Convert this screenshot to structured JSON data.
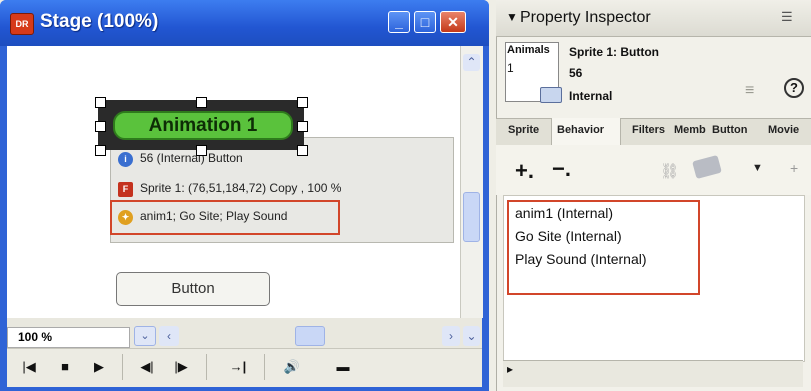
{
  "stage": {
    "title": "Stage (100%)",
    "app_icon": "DR",
    "window_buttons": {
      "minimize": "_",
      "maximize": "□",
      "close": "✕"
    },
    "sprite_button_label": "Animation 1",
    "info_rows": [
      "56 (Internal) Button",
      "Sprite 1: (76,51,184,72) Copy , 100 %",
      "anim1; Go Site; Play Sound"
    ],
    "plain_button_label": "Button",
    "zoom_value": "100 %",
    "controls": [
      "|◀",
      "■",
      "▶",
      "◀|",
      "|▶",
      "→|",
      "🔊",
      "▬"
    ]
  },
  "inspector": {
    "title": "Property Inspector",
    "collapse_glyph": "▼",
    "thumbnail_label": "Animals",
    "thumbnail_number": "1",
    "sprite_name": "Sprite 1: Button",
    "sprite_size": "56",
    "sprite_cast": "Internal",
    "tabs": [
      "Sprite",
      "Behavior",
      "Filters",
      "Memb",
      "Button",
      "Movie"
    ],
    "active_tab": "Behavior",
    "add_label": "+.",
    "remove_label": "−.",
    "behaviors": [
      "anim1 (Internal)",
      "Go Site (Internal)",
      "Play Sound (Internal)"
    ]
  },
  "colors": {
    "titlebar": "#2256d2",
    "highlight_box": "#d2462a",
    "button_green": "#5ac23c"
  }
}
